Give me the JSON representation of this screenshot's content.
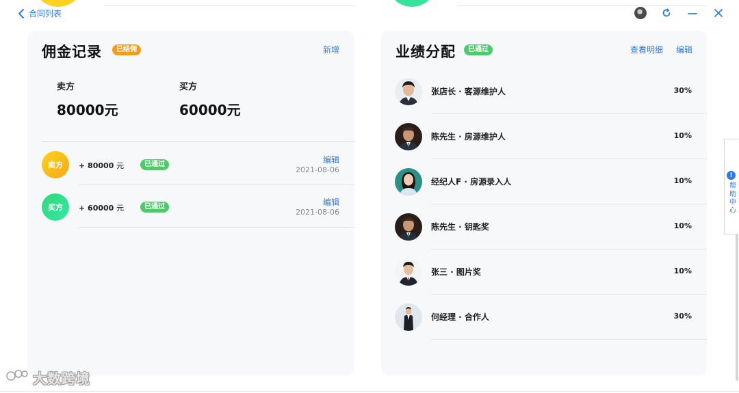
{
  "nav": {
    "back_label": "合同列表"
  },
  "colors": {
    "accent": "#2d7be0",
    "badge_orange": "#f39c1b",
    "badge_green": "#4bcb6a"
  },
  "commission": {
    "title": "佣金记录",
    "status_badge": "已结佣",
    "add_label": "新增",
    "seller": {
      "label": "卖方",
      "amount": "80000元"
    },
    "buyer": {
      "label": "买方",
      "amount": "60000元"
    },
    "records": [
      {
        "party": "卖方",
        "amount": "+ 80000",
        "unit": "元",
        "status": "已通过",
        "edit": "编辑",
        "date": "2021-08-06"
      },
      {
        "party": "买方",
        "amount": "+ 60000",
        "unit": "元",
        "status": "已通过",
        "edit": "编辑",
        "date": "2021-08-06"
      }
    ]
  },
  "performance": {
    "title": "业绩分配",
    "status_badge": "已通过",
    "detail_label": "查看明细",
    "edit_label": "编辑",
    "items": [
      {
        "name": "张店长 · 客源维护人",
        "percent": "30%",
        "avatar": "avatar-man-1"
      },
      {
        "name": "陈先生 · 房源维护人",
        "percent": "10%",
        "avatar": "avatar-man-2"
      },
      {
        "name": "经纪人F · 房源录入人",
        "percent": "10%",
        "avatar": "avatar-woman"
      },
      {
        "name": "陈先生 · 钥匙奖",
        "percent": "10%",
        "avatar": "avatar-man-2"
      },
      {
        "name": "张三 · 图片奖",
        "percent": "10%",
        "avatar": "avatar-man-3"
      },
      {
        "name": "何经理 · 合作人",
        "percent": "30%",
        "avatar": "avatar-man-4"
      }
    ]
  },
  "help": {
    "label": "帮助中心",
    "icon": "!"
  },
  "watermark": {
    "text": "大数跨境"
  }
}
